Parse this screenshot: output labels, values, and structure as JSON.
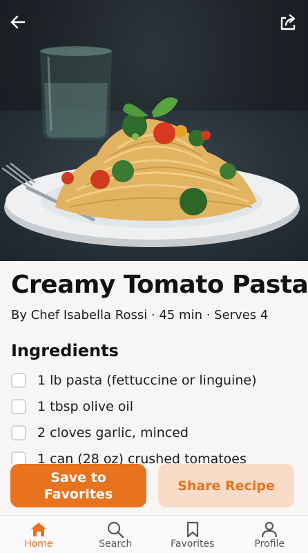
{
  "header": {
    "back_icon": "arrow-left-icon",
    "share_icon": "share-out-icon"
  },
  "recipe": {
    "title": "Creamy Tomato Pasta",
    "meta": "By Chef Isabella Rossi · 45 min · Serves 4",
    "image_alt": "Plate of spaghetti with broccoli and cherry tomatoes"
  },
  "ingredients": {
    "heading": "Ingredients",
    "items": [
      {
        "label": "1 lb pasta (fettuccine or linguine)",
        "checked": false
      },
      {
        "label": "1 tbsp olive oil",
        "checked": false
      },
      {
        "label": "2 cloves garlic, minced",
        "checked": false
      },
      {
        "label": "1 can (28 oz) crushed tomatoes",
        "checked": false
      }
    ]
  },
  "actions": {
    "save_line1": "Save to",
    "save_line2": "Favorites",
    "share_label": "Share Recipe"
  },
  "tabs": [
    {
      "label": "Home",
      "icon": "home-icon",
      "active": true
    },
    {
      "label": "Search",
      "icon": "search-icon",
      "active": false
    },
    {
      "label": "Favorites",
      "icon": "bookmark-icon",
      "active": false
    },
    {
      "label": "Profile",
      "icon": "user-icon",
      "active": false
    }
  ],
  "colors": {
    "accent": "#e8731f",
    "accent_light": "#f8dcc8"
  }
}
